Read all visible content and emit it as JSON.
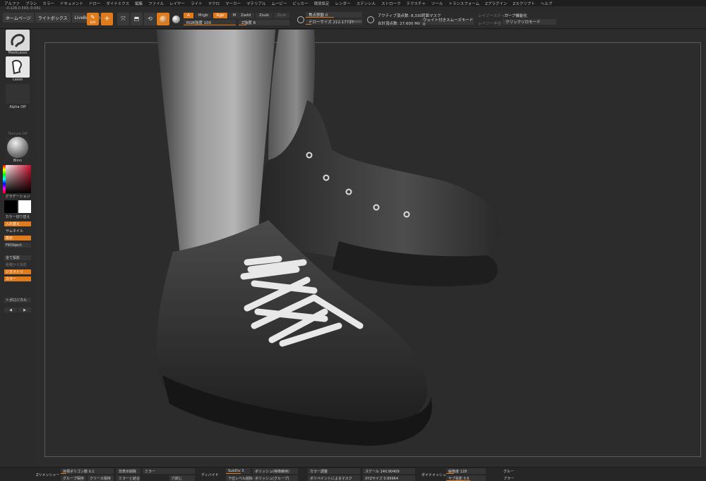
{
  "menu": [
    "アルファ",
    "ブラシ",
    "カラー",
    "ドキュメント",
    "ドロー",
    "ダイナミクス",
    "編集",
    "ファイル",
    "レイヤー",
    "ライト",
    "マクロ",
    "マーカー",
    "マテリアル",
    "ムービー",
    "ピッカー",
    "環境設定",
    "レンダー",
    "ステンシル",
    "ストローク",
    "テクスチャ",
    "ツール",
    "トランスフォーム",
    "Zプラグイン",
    "Zスクリプト",
    "ヘルプ"
  ],
  "coords": "-0.228,0.593,-0.081",
  "tabs": [
    "ホームページ",
    "ライトボックス",
    "LiveBoolean"
  ],
  "toolbar": {
    "edit_label": "Edit",
    "draw_label": "Draw",
    "a_label": "A",
    "mrgb": "Mrgb",
    "rgb": "Rgb",
    "m": "M",
    "zadd": "Zadd",
    "zsub": "Zsub",
    "zcut": "Zcut",
    "rgb_intensity": "RGB強度 100",
    "z_intensity": "Z強度 8",
    "focal_shift": "焦点移動 0",
    "draw_size": "ドローサイズ 212.17717",
    "dynamic": "Dynamic",
    "active_points": "アクティブ頂点数: 8,330",
    "total_points": "合計頂点数: 27.600 Mil",
    "backface_mask": "背面マスク",
    "weighted_smooth": "ウェイト付きスムーズモード 0",
    "lazy_step": "レイジーステップ",
    "lazy_radius": "レイジー半径",
    "curve_function": "カーブ機能化",
    "click_curve_mode": "クリックソロモード"
  },
  "left": {
    "mask_lasso": "MaskLasso",
    "lasso": "Lasso",
    "alpha_off": "Alpha Off",
    "texture_off": "Texture Off",
    "material": "Blinn",
    "gradient": "グラデーション",
    "color_switch": "カラー切り替え",
    "swap": "入れ替え",
    "thumbnail": "サムネイル",
    "show": "表示",
    "fill_object": "FillObject",
    "project_all": "全て投影",
    "project_from_dist": "距離から投影",
    "geometry": "ジオメトリ",
    "color": "カラー",
    "topological": "トポロジカル",
    "left_arrow": "◀",
    "right_arrow": "▶"
  },
  "bottom": {
    "zremesher": "Zリメッシャー",
    "target_polys": "目標ポリゴン数 0.1",
    "keep_groups": "グループ保持",
    "keep_creases": "クリース保持",
    "del_hidden": "非表示削除",
    "mirror_weld": "ミラーと結合",
    "mirror": "ミラー",
    "close_holes": "穴閉じ",
    "divide": "ディバイド",
    "subdiv": "SubDiv 3",
    "del_lower": "下位レベル削除",
    "polish_features": "ポリッシュ(特徴維持)",
    "polish_groups": "ポリッシュ(グループ)",
    "color_adjust": "カラー調整",
    "polypaint_mask": "ポリペイントによるマスク",
    "scale": "スケール 140.90409",
    "xyz_size": "XYZサイズ 0.89964",
    "dynamesh": "ダイナメッシュ",
    "resolution": "解像度 128",
    "sub_project": "サブ投影 0.6",
    "group": "グルー",
    "blur": "ブラー"
  },
  "colors": {
    "accent": "#e07a1a",
    "panel": "#2b2b2b",
    "canvas": "#2c2c2c"
  },
  "icons": [
    "edit-icon",
    "draw-icon",
    "move-icon",
    "scale-icon",
    "rotate-icon",
    "material-sphere-icon",
    "focal-icon",
    "draw-size-icon"
  ]
}
